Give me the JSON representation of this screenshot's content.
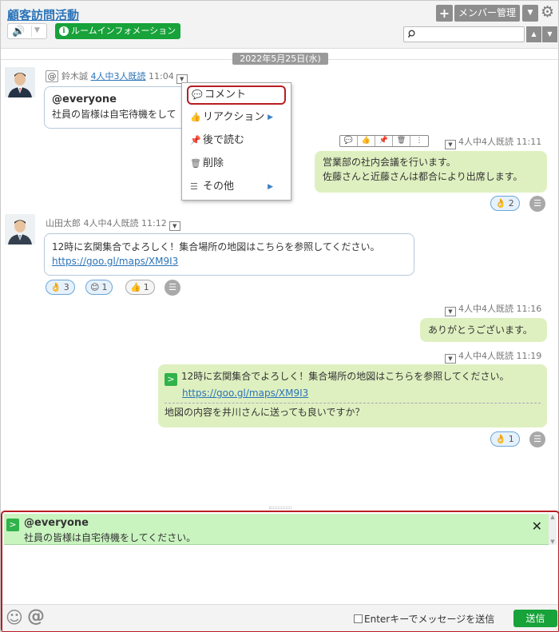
{
  "header": {
    "room_title": "顧客訪問活動",
    "room_info_label": "ルームインフォメーション",
    "member_label": "メンバー管理",
    "search_placeholder": ""
  },
  "icons": {
    "speaker": "speaker-icon",
    "plus": "plus-icon",
    "gear": "gear-icon",
    "search": "search-icon",
    "smile": "smile-icon",
    "at": "at-icon"
  },
  "colors": {
    "accent_green": "#17a23a",
    "link_blue": "#2a73b8",
    "bubble_mine": "#dff0c0",
    "highlight_red": "#b81d24"
  },
  "date_divider": "2022年5月25日(水)",
  "messages": [
    {
      "sender": "鈴木誠",
      "read": "4人中3人既読",
      "time": "11:04",
      "line1": "@everyone",
      "line2": "社員の皆様は自宅待機をして"
    },
    {
      "read": "4人中4人既読",
      "time": "11:11",
      "line1": "営業部の社内会議を行います。",
      "line2": "佐藤さんと近藤さんは都合により出席します。",
      "reactions": [
        {
          "emoji": "👌",
          "count": "2"
        }
      ]
    },
    {
      "sender": "山田太郎",
      "read": "4人中4人既読",
      "time": "11:12",
      "line1": "12時に玄関集合でよろしく！集合場所の地図はこちらを参照してください。",
      "link": "https://goo.gl/maps/XM9I3",
      "reactions": [
        {
          "emoji": "👌",
          "count": "3"
        },
        {
          "emoji": "😊",
          "count": "1"
        },
        {
          "emoji": "👍",
          "count": "1"
        }
      ]
    },
    {
      "read": "4人中4人既読",
      "time": "11:16",
      "line1": "ありがとうございます。"
    },
    {
      "read": "4人中4人既読",
      "time": "11:19",
      "quote_line1": "12時に玄関集合でよろしく！集合場所の地図はこちらを参照してください。",
      "quote_link": "https://goo.gl/maps/XM9I3",
      "reply": "地図の内容を井川さんに送っても良いですか？",
      "reactions": [
        {
          "emoji": "👌",
          "count": "1"
        }
      ]
    }
  ],
  "context_menu": {
    "items": [
      {
        "label": "コメント",
        "icon": "comment-icon"
      },
      {
        "label": "リアクション",
        "icon": "thumbs-up-icon"
      },
      {
        "label": "後で読む",
        "icon": "pin-icon"
      },
      {
        "label": "削除",
        "icon": "trash-icon"
      },
      {
        "label": "その他",
        "icon": "menu-lines-icon"
      }
    ]
  },
  "compose": {
    "quote_line1": "@everyone",
    "quote_line2": "社員の皆様は自宅待機をしてください。",
    "text_value": "",
    "enter_option_label": "Enterキーでメッセージを送信",
    "send_label": "送信"
  }
}
